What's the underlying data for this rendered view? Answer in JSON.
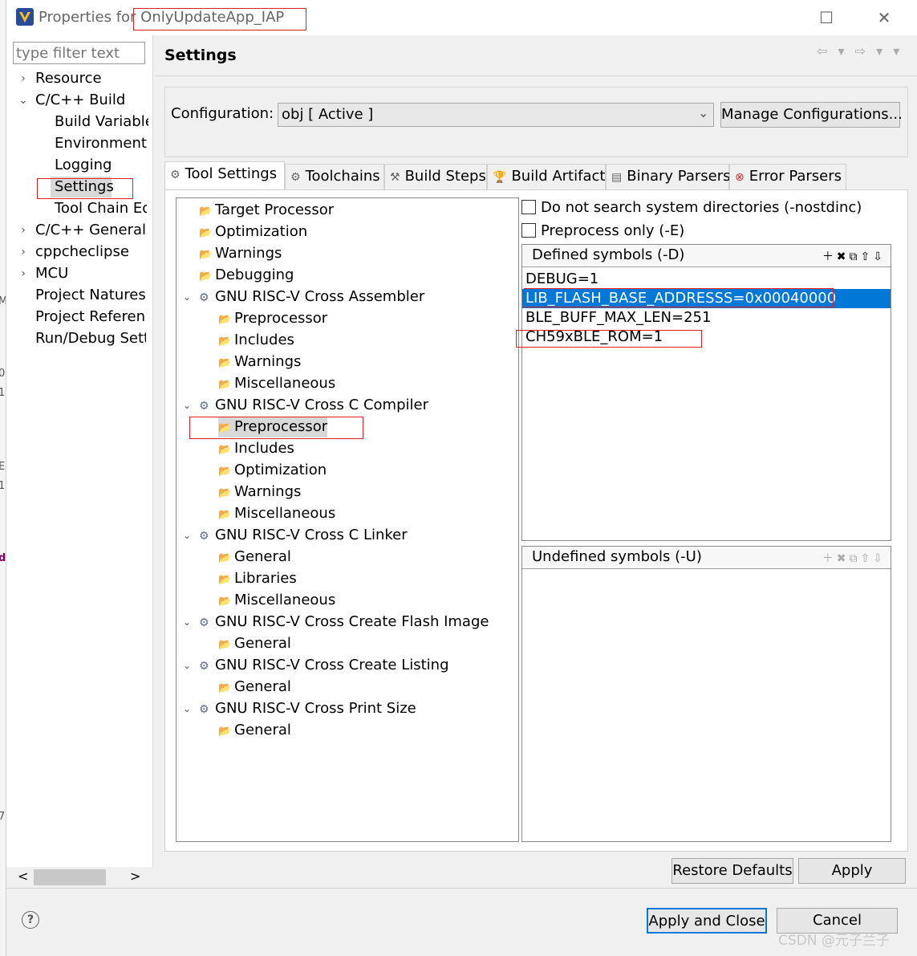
{
  "window": {
    "title_prefix": "Properties for ",
    "project_name": "OnlyUpdateApp_IAP",
    "maximize_glyph": "☐",
    "close_glyph": "✕"
  },
  "nav": {
    "filter_placeholder": "type filter text",
    "items": [
      {
        "label": "Resource",
        "chevron": "›"
      },
      {
        "label": "C/C++ Build",
        "chevron": "⌄"
      },
      {
        "label": "Build Variables"
      },
      {
        "label": "Environment"
      },
      {
        "label": "Logging"
      },
      {
        "label": "Settings"
      },
      {
        "label": "Tool Chain Editor"
      },
      {
        "label": "C/C++ General",
        "chevron": "›"
      },
      {
        "label": "cppcheclipse",
        "chevron": "›"
      },
      {
        "label": "MCU",
        "chevron": "›"
      },
      {
        "label": "Project Natures"
      },
      {
        "label": "Project References"
      },
      {
        "label": "Run/Debug Settings"
      }
    ],
    "scroll_left": "<",
    "scroll_right": ">"
  },
  "content": {
    "title": "Settings",
    "history": "⇦ ▾ ⇨ ▾ ▾"
  },
  "config": {
    "label": "Configuration:",
    "value": "obj  [ Active ]",
    "manage_label": "Manage Configurations..."
  },
  "tabs": [
    {
      "label": "Tool Settings",
      "icon": "⚙"
    },
    {
      "label": "Toolchains",
      "icon": "⚙"
    },
    {
      "label": "Build Steps",
      "icon": "⚒"
    },
    {
      "label": "Build Artifact",
      "icon": "🏆"
    },
    {
      "label": "Binary Parsers",
      "icon": "▤"
    },
    {
      "label": "Error Parsers",
      "icon": "⊗"
    }
  ],
  "tree": [
    {
      "label": "Target Processor"
    },
    {
      "label": "Optimization"
    },
    {
      "label": "Warnings"
    },
    {
      "label": "Debugging"
    },
    {
      "label": "GNU RISC-V Cross Assembler",
      "expander": "⌄"
    },
    {
      "label": "Preprocessor"
    },
    {
      "label": "Includes"
    },
    {
      "label": "Warnings"
    },
    {
      "label": "Miscellaneous"
    },
    {
      "label": "GNU RISC-V Cross C Compiler",
      "expander": "⌄"
    },
    {
      "label": "Preprocessor"
    },
    {
      "label": "Includes"
    },
    {
      "label": "Optimization"
    },
    {
      "label": "Warnings"
    },
    {
      "label": "Miscellaneous"
    },
    {
      "label": "GNU RISC-V Cross C Linker",
      "expander": "⌄"
    },
    {
      "label": "General"
    },
    {
      "label": "Libraries"
    },
    {
      "label": "Miscellaneous"
    },
    {
      "label": "GNU RISC-V Cross Create Flash Image",
      "expander": "⌄"
    },
    {
      "label": "General"
    },
    {
      "label": "GNU RISC-V Cross Create Listing",
      "expander": "⌄"
    },
    {
      "label": "General"
    },
    {
      "label": "GNU RISC-V Cross Print Size",
      "expander": "⌄"
    },
    {
      "label": "General"
    }
  ],
  "options": {
    "nostdinc_label": "Do not search system directories (-nostdinc)",
    "preprocess_only_label": "Preprocess only (-E)"
  },
  "defined": {
    "title": "Defined symbols (-D)",
    "tools": "＋✖⧉⇧⇩",
    "symbols": [
      "DEBUG=1",
      "LIB_FLASH_BASE_ADDRESSS=0x00040000",
      "BLE_BUFF_MAX_LEN=251",
      "CH59xBLE_ROM=1"
    ]
  },
  "undefined": {
    "title": "Undefined symbols (-U)",
    "tools": "＋✖⧉⇧⇩"
  },
  "buttons": {
    "restore_defaults": "Restore Defaults",
    "apply": "Apply",
    "apply_and_close": "Apply and Close",
    "cancel": "Cancel",
    "help": "?"
  },
  "watermark": "CSDN @元子兰子",
  "colors": {
    "selection": "#0078d7",
    "annotation": "#e02020"
  }
}
